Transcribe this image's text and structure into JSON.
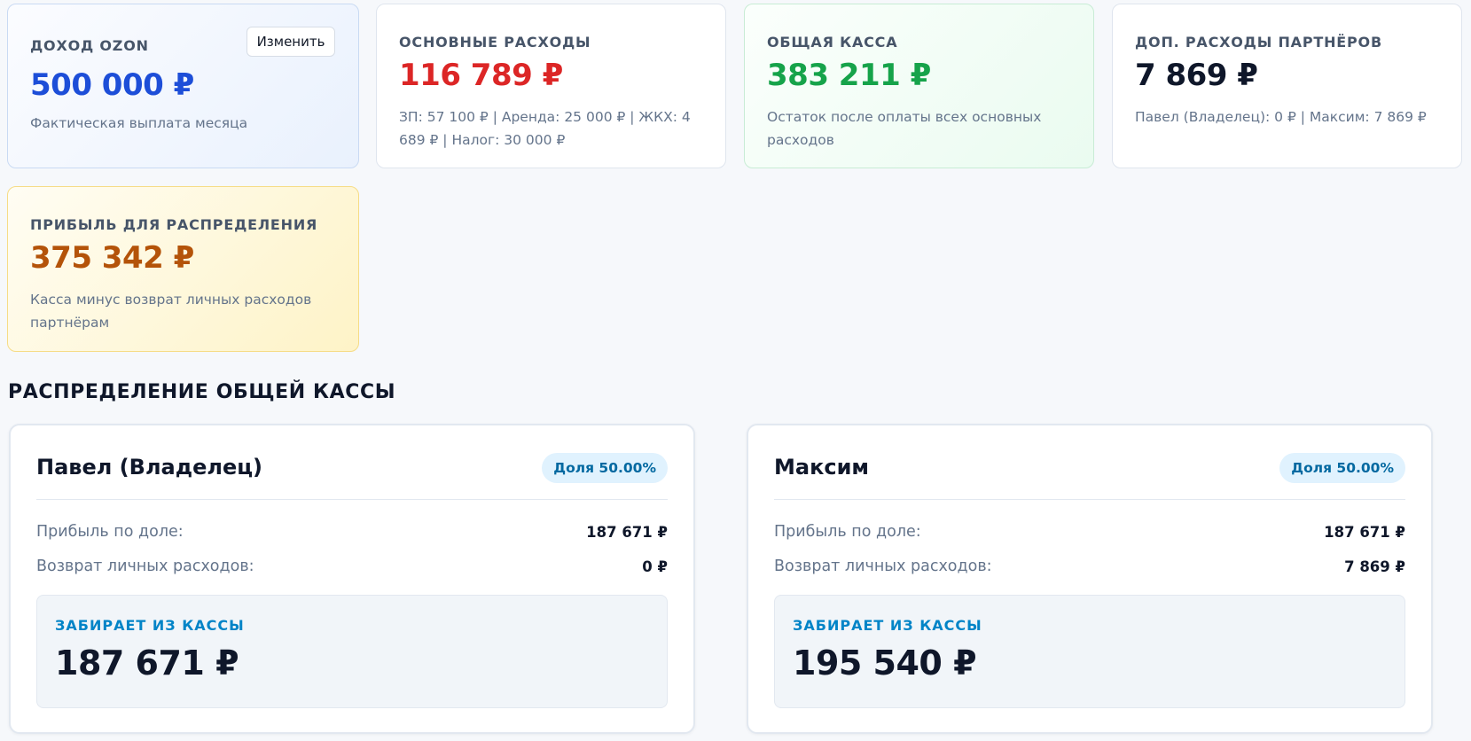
{
  "colors": {
    "income_value": "#1d4ed8",
    "expenses_value": "#dc2626",
    "cash_value": "#16a34a",
    "partners_value": "#0f172a",
    "profit_value": "#b45309",
    "share_badge_bg": "#e0f2fe",
    "share_badge_text": "#0369a1",
    "take_label": "#0284c7"
  },
  "cards": {
    "income": {
      "label": "Доход OZON",
      "value": "500 000 ₽",
      "description": "Фактическая выплата месяца",
      "edit_button": "Изменить"
    },
    "expenses": {
      "label": "Основные расходы",
      "value": "116 789 ₽",
      "description": "ЗП: 57 100 ₽ | Аренда: 25 000 ₽ | ЖКХ: 4 689 ₽ | Налог: 30 000 ₽"
    },
    "cash": {
      "label": "Общая касса",
      "value": "383 211 ₽",
      "description": "Остаток после оплаты всех основных расходов"
    },
    "partners": {
      "label": "Доп. расходы партнёров",
      "value": "7 869 ₽",
      "description": "Павел (Владелец): 0 ₽ | Максим: 7 869 ₽"
    },
    "profit": {
      "label": "Прибыль для распределения",
      "value": "375 342 ₽",
      "description": "Касса минус возврат личных расходов партнёрам"
    }
  },
  "distribution": {
    "title": "РАСПРЕДЕЛЕНИЕ ОБЩЕЙ КАССЫ",
    "partners": [
      {
        "name": "Павел (Владелец)",
        "share": "Доля 50.00%",
        "profit_label": "Прибыль по доле:",
        "profit_value": "187 671 ₽",
        "refund_label": "Возврат личных расходов:",
        "refund_value": "0 ₽",
        "take_label": "Забирает из кассы",
        "take_value": "187 671 ₽"
      },
      {
        "name": "Максим",
        "share": "Доля 50.00%",
        "profit_label": "Прибыль по доле:",
        "profit_value": "187 671 ₽",
        "refund_label": "Возврат личных расходов:",
        "refund_value": "7 869 ₽",
        "take_label": "Забирает из кассы",
        "take_value": "195 540 ₽"
      }
    ]
  }
}
